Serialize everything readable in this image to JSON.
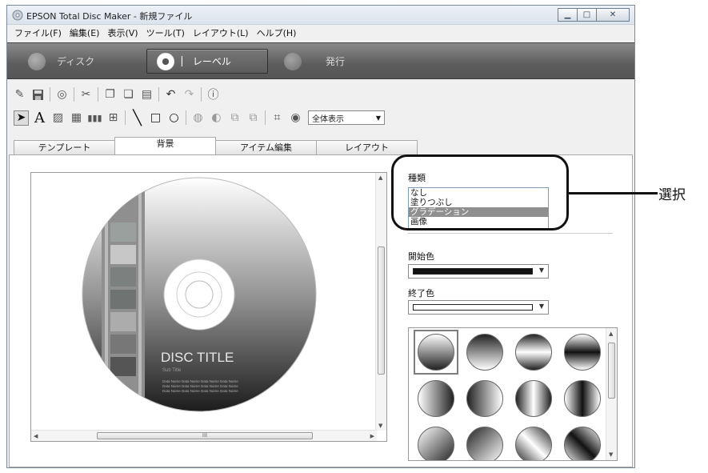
{
  "window": {
    "title": "EPSON Total Disc Maker - 新規ファイル"
  },
  "menu": [
    "ファイル(F)",
    "編集(E)",
    "表示(V)",
    "ツール(T)",
    "レイアウト(L)",
    "ヘルプ(H)"
  ],
  "modes": [
    {
      "label": "ディスク",
      "active": false
    },
    {
      "label": "レーベル",
      "active": true
    },
    {
      "label": "発行",
      "active": false
    }
  ],
  "toolbar": {
    "zoom_value": "全体表示"
  },
  "tabs": [
    {
      "label": "テンプレート",
      "active": false
    },
    {
      "label": "背景",
      "active": true
    },
    {
      "label": "アイテム編集",
      "active": false
    },
    {
      "label": "レイアウト",
      "active": false
    }
  ],
  "canvas": {
    "disc_title": "DISC TITLE",
    "sub_title": "Sub Title",
    "data_lines": [
      "Data Name Data Name Data Name Data Name",
      "Data Name Data Name Data Name Data Name",
      "Data Name Data Name Data Name Data Name"
    ],
    "hscroll_grip": "III"
  },
  "background_panel": {
    "kind_label": "種類",
    "kind_options": [
      "なし",
      "塗りつぶし",
      "グラデーション",
      "画像"
    ],
    "kind_selected_index": 2,
    "start_color_label": "開始色",
    "start_color": "#111111",
    "end_color_label": "終了色",
    "end_color": "#ffffff",
    "gradient_presets_selected_index": 0
  },
  "annotation": {
    "text": "選択"
  },
  "colors": {
    "mode_bar": "#666666",
    "selection": "#8f8f8f"
  }
}
